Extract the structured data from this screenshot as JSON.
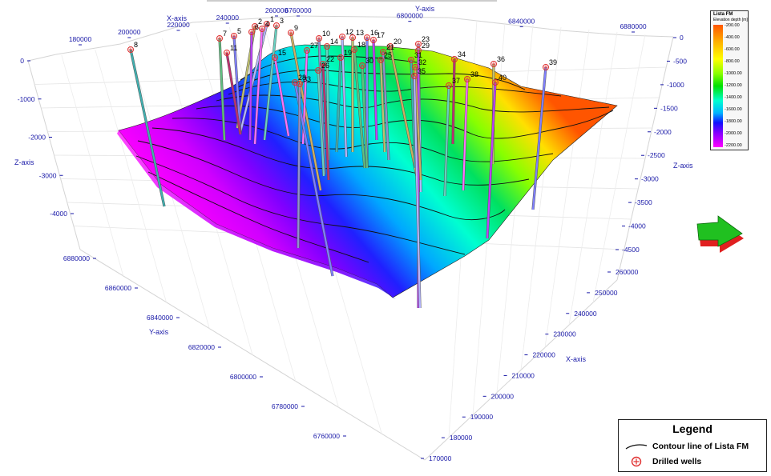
{
  "chart_data": {
    "type": "surface",
    "title": "",
    "surface_name": "Lista FM",
    "axes": {
      "x": {
        "label": "X-axis",
        "ticks": [
          "170000",
          "180000",
          "190000",
          "200000",
          "210000",
          "220000",
          "230000",
          "240000",
          "250000",
          "260000"
        ]
      },
      "x_back": {
        "label": "X-axis",
        "ticks": [
          "180000",
          "200000",
          "220000",
          "240000",
          "260000"
        ]
      },
      "y": {
        "label": "Y-axis",
        "ticks": [
          "6760000",
          "6780000",
          "6800000",
          "6820000",
          "6840000",
          "6860000",
          "6880000"
        ]
      },
      "y_back": {
        "label": "Y-axis",
        "ticks": [
          "6760000",
          "6800000",
          "6840000",
          "6880000"
        ]
      },
      "z": {
        "label": "Z-axis",
        "ticks": [
          "0",
          "-500",
          "-1000",
          "-1500",
          "-2000",
          "-2500",
          "-3000",
          "-3500",
          "-4000",
          "-4500"
        ]
      },
      "z_left": {
        "label": "Z-axis",
        "ticks": [
          "0",
          "-1000",
          "-2000",
          "-3000",
          "-4000"
        ]
      }
    },
    "colorbar": {
      "title": "Lista FM",
      "subtitle": "Elevation depth [m]",
      "labels": [
        "-200.00",
        "-400.00",
        "-600.00",
        "-800.00",
        "-1000.00",
        "-1200.00",
        "-1400.00",
        "-1600.00",
        "-1800.00",
        "-2000.00",
        "-2200.00"
      ],
      "range": [
        -2200,
        -200
      ]
    },
    "wells": [
      "1",
      "2",
      "3",
      "4",
      "5",
      "6",
      "7",
      "8",
      "9",
      "10",
      "11",
      "12",
      "13",
      "14",
      "15",
      "16",
      "17",
      "18",
      "19",
      "20",
      "21",
      "22",
      "23",
      "25",
      "26",
      "27",
      "28",
      "29",
      "30",
      "31",
      "32",
      "33",
      "34",
      "35",
      "36",
      "37",
      "38",
      "39",
      "40"
    ],
    "grid": true
  },
  "legend": {
    "title": "Legend",
    "contour_label": "Contour line of Lista FM",
    "wells_label": "Drilled wells"
  },
  "colors": {
    "axis_text": "#1a1aa8",
    "contour": "#111111",
    "well_marker": "#e03030"
  }
}
